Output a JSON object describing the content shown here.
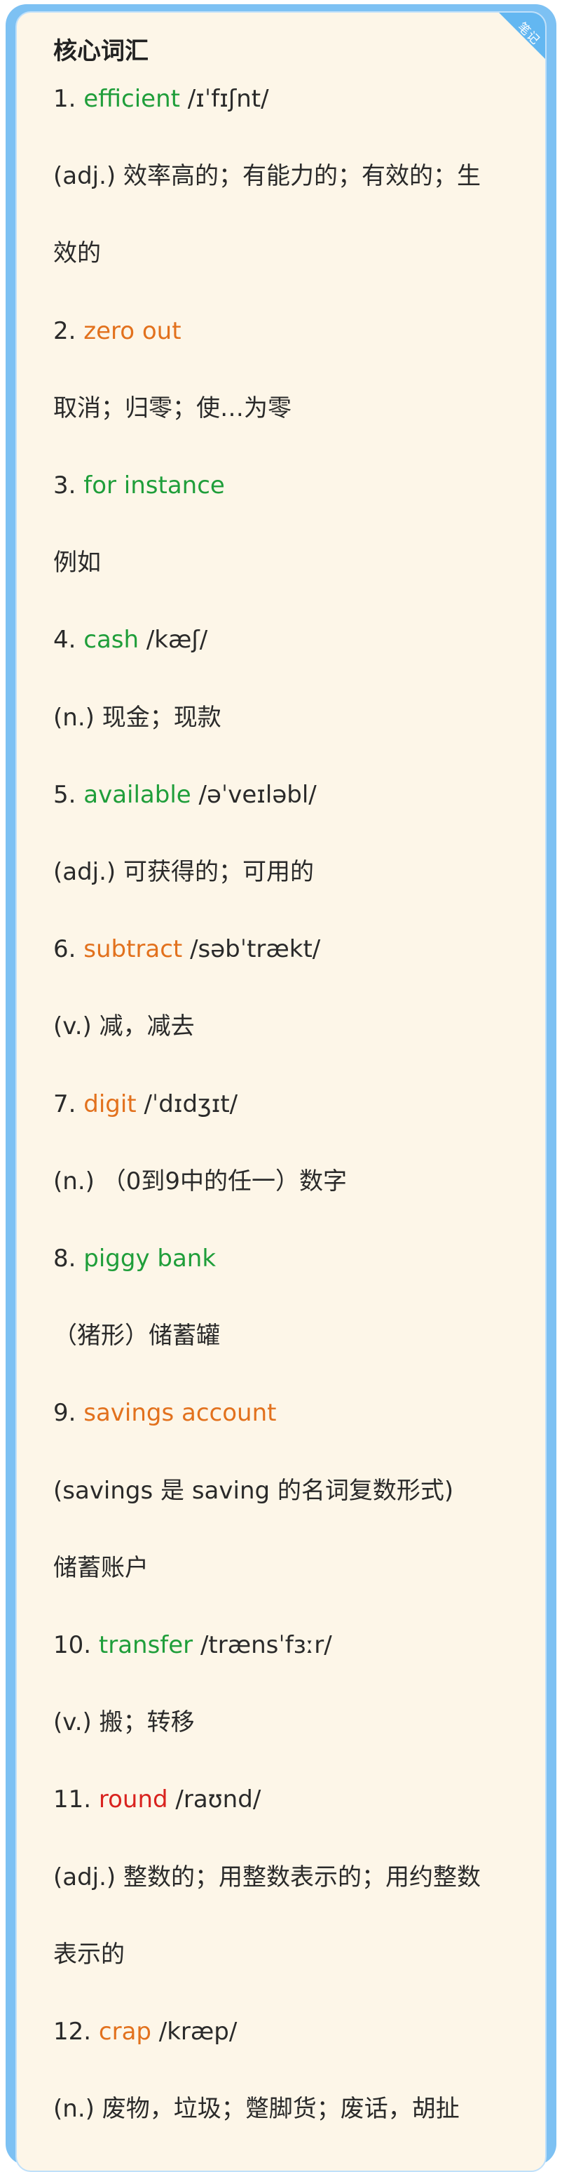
{
  "card": {
    "title": "核心词汇",
    "corner_tag": "笔记",
    "colors": {
      "frame": "#7dc1f3",
      "background": "#fdf6e8",
      "green": "#1f9e3a",
      "orange": "#e2711d",
      "red": "#d9231f"
    }
  },
  "lines": [
    {
      "num": "1. ",
      "word": "efficient",
      "color": "green",
      "phonetic": " /ɪˈfɪʃnt/"
    },
    {
      "text": "(adj.) 效率高的；有能力的；有效的；生"
    },
    {
      "text": "效的"
    },
    {
      "num": "2. ",
      "word": "zero out",
      "color": "orange",
      "phonetic": ""
    },
    {
      "text": "取消；归零；使…为零"
    },
    {
      "num": "3. ",
      "word": "for instance",
      "color": "green",
      "phonetic": ""
    },
    {
      "text": "例如"
    },
    {
      "num": "4. ",
      "word": "cash",
      "color": "green",
      "phonetic": " /kæʃ/"
    },
    {
      "text": "(n.) 现金；现款"
    },
    {
      "num": "5. ",
      "word": "available",
      "color": "green",
      "phonetic": " /əˈveɪləbl/"
    },
    {
      "text": "(adj.) 可获得的；可用的"
    },
    {
      "num": "6. ",
      "word": "subtract",
      "color": "orange",
      "phonetic": " /səbˈtrækt/"
    },
    {
      "text": "(v.) 减，减去"
    },
    {
      "num": "7. ",
      "word": "digit",
      "color": "orange",
      "phonetic": " /ˈdɪdʒɪt/"
    },
    {
      "text": "(n.) （0到9中的任一）数字"
    },
    {
      "num": "8. ",
      "word": "piggy bank",
      "color": "green",
      "phonetic": ""
    },
    {
      "text": "（猪形）储蓄罐"
    },
    {
      "num": "9. ",
      "word": "savings account",
      "color": "orange",
      "phonetic": ""
    },
    {
      "text": "(savings 是 saving 的名词复数形式)"
    },
    {
      "text": "储蓄账户"
    },
    {
      "num": "10. ",
      "word": "transfer",
      "color": "green",
      "phonetic": " /trænsˈfɜːr/"
    },
    {
      "text": "(v.) 搬；转移"
    },
    {
      "num": "11. ",
      "word": "round",
      "color": "red",
      "phonetic": " /raʊnd/"
    },
    {
      "text": "(adj.) 整数的；用整数表示的；用约整数"
    },
    {
      "text": "表示的"
    },
    {
      "num": "12. ",
      "word": "crap",
      "color": "orange",
      "phonetic": " /kræp/"
    },
    {
      "text": "(n.) 废物，垃圾；蹩脚货；废话，胡扯"
    }
  ]
}
